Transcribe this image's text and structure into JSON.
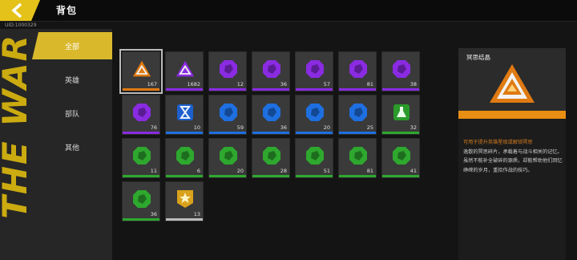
{
  "header": {
    "title": "背包",
    "uid": "UID:1000329"
  },
  "side_decor_text": "THE WAR",
  "tabs": [
    {
      "label": "全部",
      "active": true
    },
    {
      "label": "英雄",
      "active": false
    },
    {
      "label": "部队",
      "active": false
    },
    {
      "label": "其他",
      "active": false
    }
  ],
  "items": [
    {
      "row": 0,
      "col": 0,
      "count": "167",
      "color": "#e07a12",
      "icon": "triangle-crystal-icon",
      "selected": true
    },
    {
      "row": 0,
      "col": 1,
      "count": "1682",
      "color": "#8a2be2",
      "icon": "triangle-crystal-icon"
    },
    {
      "row": 0,
      "col": 2,
      "count": "12",
      "color": "#8a2be2",
      "icon": "octagon-shard-icon"
    },
    {
      "row": 0,
      "col": 3,
      "count": "36",
      "color": "#8a2be2",
      "icon": "octagon-shard-icon"
    },
    {
      "row": 0,
      "col": 4,
      "count": "57",
      "color": "#8a2be2",
      "icon": "octagon-shard-icon"
    },
    {
      "row": 0,
      "col": 5,
      "count": "81",
      "color": "#8a2be2",
      "icon": "octagon-shard-icon"
    },
    {
      "row": 0,
      "col": 6,
      "count": "38",
      "color": "#8a2be2",
      "icon": "octagon-shard-icon"
    },
    {
      "row": 1,
      "col": 0,
      "count": "76",
      "color": "#8a2be2",
      "icon": "octagon-shard-icon"
    },
    {
      "row": 1,
      "col": 1,
      "count": "10",
      "color": "#1e6fe0",
      "icon": "hourglass-icon"
    },
    {
      "row": 1,
      "col": 2,
      "count": "59",
      "color": "#1e6fe0",
      "icon": "octagon-shard-icon"
    },
    {
      "row": 1,
      "col": 3,
      "count": "36",
      "color": "#1e6fe0",
      "icon": "octagon-shard-icon"
    },
    {
      "row": 1,
      "col": 4,
      "count": "20",
      "color": "#1e6fe0",
      "icon": "octagon-shard-icon"
    },
    {
      "row": 1,
      "col": 5,
      "count": "25",
      "color": "#1e6fe0",
      "icon": "octagon-shard-icon"
    },
    {
      "row": 1,
      "col": 6,
      "count": "32",
      "color": "#2ea82e",
      "icon": "flask-icon"
    },
    {
      "row": 2,
      "col": 0,
      "count": "11",
      "color": "#2ea82e",
      "icon": "octagon-shard-icon"
    },
    {
      "row": 2,
      "col": 1,
      "count": "6",
      "color": "#2ea82e",
      "icon": "octagon-shard-icon"
    },
    {
      "row": 2,
      "col": 2,
      "count": "20",
      "color": "#2ea82e",
      "icon": "octagon-shard-icon"
    },
    {
      "row": 2,
      "col": 3,
      "count": "28",
      "color": "#2ea82e",
      "icon": "octagon-shard-icon"
    },
    {
      "row": 2,
      "col": 4,
      "count": "51",
      "color": "#2ea82e",
      "icon": "octagon-shard-icon"
    },
    {
      "row": 2,
      "col": 5,
      "count": "81",
      "color": "#2ea82e",
      "icon": "octagon-shard-icon"
    },
    {
      "row": 2,
      "col": 6,
      "count": "41",
      "color": "#2ea82e",
      "icon": "octagon-shard-icon"
    },
    {
      "row": 3,
      "col": 0,
      "count": "36",
      "color": "#2ea82e",
      "icon": "octagon-shard-icon"
    },
    {
      "row": 3,
      "col": 1,
      "count": "13",
      "color": "#bcbcbc",
      "icon": "star-shield-icon"
    }
  ],
  "detail": {
    "name": "冥思结晶",
    "desc_highlight": "可用于提升英雄星级或解锁冥思",
    "desc_body": "逸散的冥思碎片，承载着与战斗相关的记忆。虽然不能补全破碎的源质，却能帮助他们回忆峥嵘的岁月，重拾作战的技巧。",
    "accent": "#e88e12"
  }
}
